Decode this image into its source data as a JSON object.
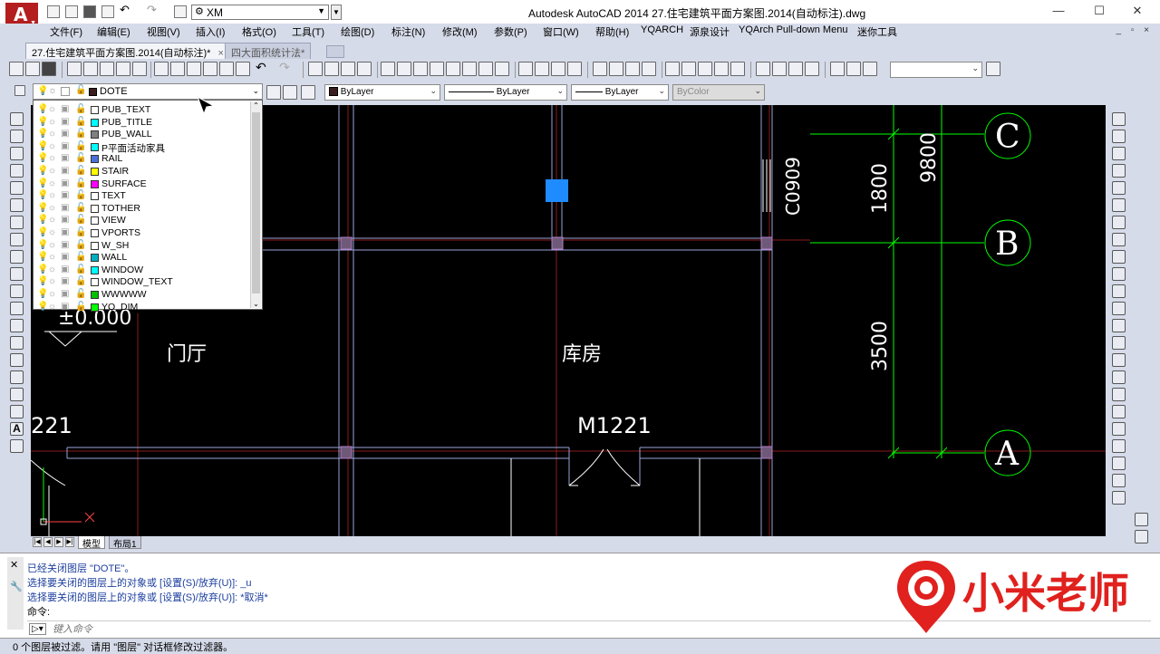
{
  "titlebar": {
    "workspace": "XM",
    "title": "Autodesk AutoCAD 2014      27.住宅建筑平面方案图.2014(自动标注).dwg",
    "minimize": "—",
    "maximize": "☐",
    "close": "✕"
  },
  "menu": {
    "items": [
      "文件(F)",
      "编辑(E)",
      "视图(V)",
      "插入(I)",
      "格式(O)",
      "工具(T)",
      "绘图(D)",
      "标注(N)",
      "修改(M)",
      "参数(P)",
      "窗口(W)",
      "帮助(H)",
      "YQARCH",
      "源泉设计",
      "YQArch Pull-down Menu",
      "迷你工具"
    ],
    "doc_controls": "_ ▫ ×"
  },
  "doc_tabs": [
    {
      "label": "27.住宅建筑平面方案图.2014(自动标注)*",
      "close": "×"
    },
    {
      "label": "四大面积统计法*",
      "close": ""
    }
  ],
  "layer_combo": {
    "current": "DOTE"
  },
  "property_combos": {
    "color": "ByLayer",
    "linetype": "ByLayer",
    "lineweight": "ByLayer",
    "plotstyle": "ByColor"
  },
  "layers": [
    {
      "name": "PUB_TEXT",
      "color": "#ffffff"
    },
    {
      "name": "PUB_TITLE",
      "color": "#00ffff"
    },
    {
      "name": "PUB_WALL",
      "color": "#808080"
    },
    {
      "name": "P平面活动家具",
      "color": "#00ffff"
    },
    {
      "name": "RAIL",
      "color": "#4a6fd8"
    },
    {
      "name": "STAIR",
      "color": "#ffff00"
    },
    {
      "name": "SURFACE",
      "color": "#ff00ff"
    },
    {
      "name": "TEXT",
      "color": "#ffffff"
    },
    {
      "name": "TOTHER",
      "color": "#ffffff"
    },
    {
      "name": "VIEW",
      "color": "#ffffff"
    },
    {
      "name": "VPORTS",
      "color": "#ffffff"
    },
    {
      "name": "W_SH",
      "color": "#ffffff"
    },
    {
      "name": "WALL",
      "color": "#00b0c0"
    },
    {
      "name": "WINDOW",
      "color": "#00ffff"
    },
    {
      "name": "WINDOW_TEXT",
      "color": "#ffffff"
    },
    {
      "name": "WWWWW",
      "color": "#00c000"
    },
    {
      "name": "YQ_DIM",
      "color": "#00ff00"
    }
  ],
  "drawing": {
    "room_label_1": "门厅",
    "room_label_2": "库房",
    "door_label_1": "M1221",
    "door_label_partial": "221",
    "window_label": "C0909",
    "elevation": "±0.000",
    "dim_1800": "1800",
    "dim_3500": "3500",
    "dim_9800": "9800",
    "grid_c": "C",
    "grid_b": "B",
    "grid_a": "A"
  },
  "layout_tabs": {
    "model": "模型",
    "layout1": "布局1"
  },
  "command": {
    "line1": "已经关闭图层 \"DOTE\"。",
    "line2": "选择要关闭的图层上的对象或 [设置(S)/放弃(U)]: _u",
    "line3": "选择要关闭的图层上的对象或 [设置(S)/放弃(U)]: *取消*",
    "line4": "命令:",
    "placeholder": "键入命令"
  },
  "watermark": {
    "text": "小米老师",
    "color": "#e0211e"
  },
  "status": {
    "text": "0 个图层被过滤。请用 \"图层\" 对话框修改过滤器。"
  }
}
